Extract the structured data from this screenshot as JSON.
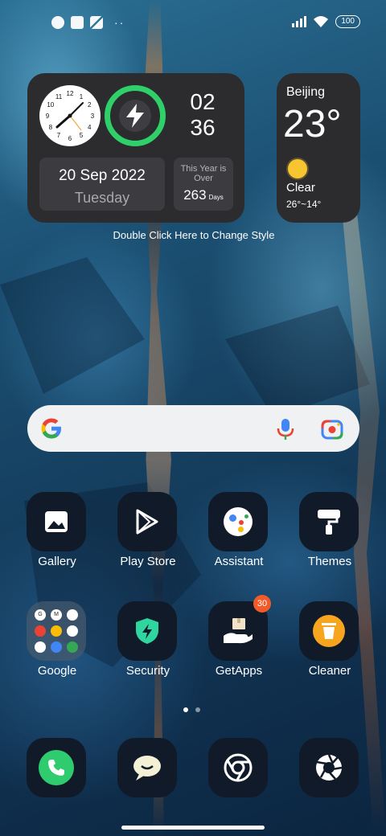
{
  "status_bar": {
    "left_icons": [
      "app-notification-icon",
      "square-notification-icon",
      "photo-notification-icon"
    ],
    "more_dots": "··",
    "signal": "signal-icon",
    "wifi": "wifi-icon",
    "battery": "100"
  },
  "widget": {
    "time_hour": "02",
    "time_minute": "36",
    "date": "20 Sep 2022",
    "weekday": "Tuesday",
    "year_label": "This Year is Over",
    "year_days": "263",
    "year_unit": "Days",
    "hint": "Double Click Here to Change Style",
    "clock_numbers": [
      "12",
      "1",
      "2",
      "3",
      "4",
      "5",
      "6",
      "7",
      "8",
      "9",
      "10",
      "11"
    ]
  },
  "weather": {
    "city": "Beijing",
    "temp": "23°",
    "condition": "Clear",
    "range": "26°~14°"
  },
  "search": {
    "logo": "google-g-icon",
    "mic": "mic-icon",
    "lens": "lens-icon"
  },
  "apps": [
    {
      "label": "Gallery",
      "icon": "gallery-icon"
    },
    {
      "label": "Play Store",
      "icon": "play-store-icon"
    },
    {
      "label": "Assistant",
      "icon": "assistant-icon"
    },
    {
      "label": "Themes",
      "icon": "themes-icon"
    },
    {
      "label": "Google",
      "icon": "google-folder-icon"
    },
    {
      "label": "Security",
      "icon": "security-icon"
    },
    {
      "label": "GetApps",
      "icon": "getapps-icon",
      "badge": "30"
    },
    {
      "label": "Cleaner",
      "icon": "cleaner-icon"
    }
  ],
  "folder_icons": [
    "G",
    "M",
    "",
    "",
    "",
    "",
    "",
    "",
    ""
  ],
  "pager": {
    "pages": 2,
    "active": 1
  },
  "dock": [
    {
      "icon": "phone-icon"
    },
    {
      "icon": "messaging-icon"
    },
    {
      "icon": "chrome-icon"
    },
    {
      "icon": "camera-icon"
    }
  ],
  "colors": {
    "widget_bg": "#2c2c2f",
    "ring_green": "#2fd06a",
    "badge_orange": "#f25a29",
    "phone_green": "#2fcc6f"
  }
}
